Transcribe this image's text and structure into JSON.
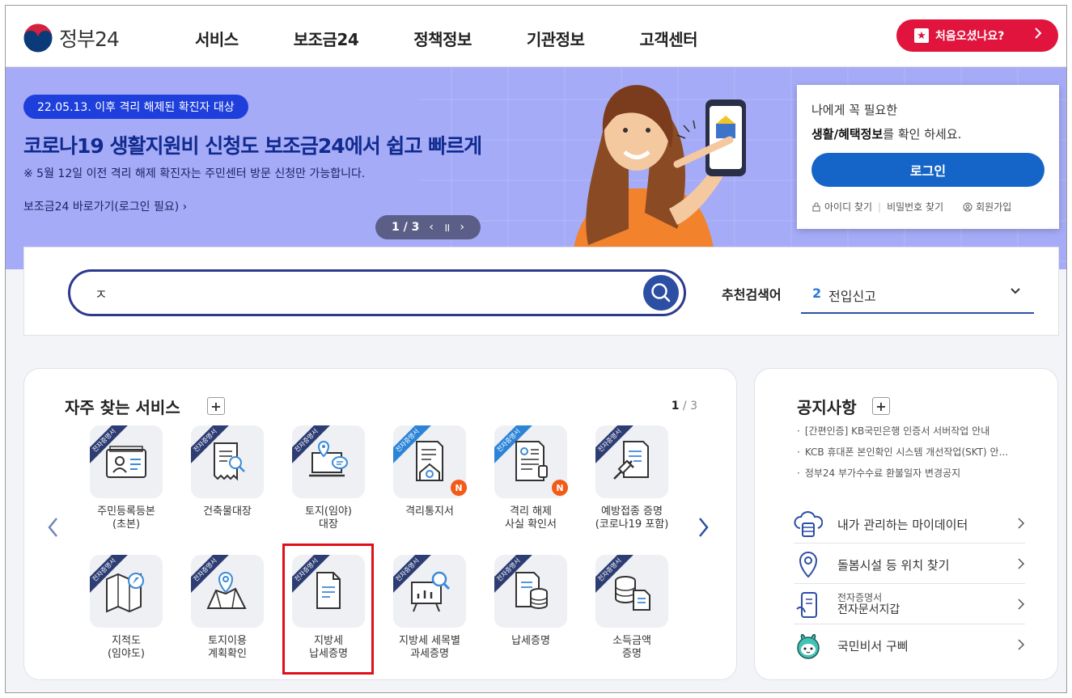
{
  "header": {
    "logo_text": "정부24",
    "nav": [
      "서비스",
      "보조금24",
      "정책정보",
      "기관정보",
      "고객센터"
    ],
    "first_visit_label": "처음오셨나요?"
  },
  "banner": {
    "tag": "22.05.13. 이후 격리 해제된 확진자 대상",
    "title": "코로나19 생활지원비 신청도 보조금24에서 쉽고 빠르게",
    "subtitle": "※ 5월 12일 이전 격리 해제 확진자는 주민센터 방문 신청만 가능합니다.",
    "link": "보조금24 바로가기(로그인 필요)",
    "pager": "1 / 3"
  },
  "login": {
    "line1": "나에게 꼭 필요한",
    "line2_bold": "생활/혜택정보",
    "line2_rest": "를 확인 하세요.",
    "button": "로그인",
    "links": [
      "아이디 찾기",
      "비밀번호 찾기",
      "회원가입"
    ]
  },
  "search": {
    "value": "ㅈ",
    "recommend_label": "추천검색어",
    "recommend_num": "2",
    "recommend_text": "전입신고"
  },
  "frequent": {
    "title": "자주 찾는 서비스",
    "page_current": "1",
    "page_total": "/ 3",
    "ribbon": "전자증명서",
    "new_badge": "N",
    "row1": [
      {
        "l1": "주민등록등본",
        "l2": "(초본)",
        "ribbon_color": "dark",
        "new": false
      },
      {
        "l1": "건축물대장",
        "l2": "",
        "ribbon_color": "dark",
        "new": false
      },
      {
        "l1": "토지(임야)",
        "l2": "대장",
        "ribbon_color": "dark",
        "new": false
      },
      {
        "l1": "격리통지서",
        "l2": "",
        "ribbon_color": "blue",
        "new": true
      },
      {
        "l1": "격리 해제",
        "l2": "사실 확인서",
        "ribbon_color": "blue",
        "new": true
      },
      {
        "l1": "예방접종 증명",
        "l2": "(코로나19 포함)",
        "ribbon_color": "dark",
        "new": false
      }
    ],
    "row2": [
      {
        "l1": "지적도",
        "l2": "(임야도)"
      },
      {
        "l1": "토지이용",
        "l2": "계획확인"
      },
      {
        "l1": "지방세",
        "l2": "납세증명"
      },
      {
        "l1": "지방세 세목별",
        "l2": "과세증명"
      },
      {
        "l1": "납세증명",
        "l2": ""
      },
      {
        "l1": "소득금액",
        "l2": "증명"
      }
    ]
  },
  "notice": {
    "title": "공지사항",
    "items": [
      "[간편인증] KB국민은행 인증서 서버작업 안내",
      "KCB 휴대폰 본인확인 시스템 개선작업(SKT) 안...",
      "정부24 부가수수료 환불일자 변경공지"
    ],
    "quick": [
      {
        "label": "내가 관리하는 마이데이터"
      },
      {
        "label": "돌봄시설 등 위치 찾기"
      },
      {
        "small": "전자증명서",
        "label": "전자문서지갑"
      },
      {
        "label": "국민비서 구삐"
      }
    ]
  }
}
